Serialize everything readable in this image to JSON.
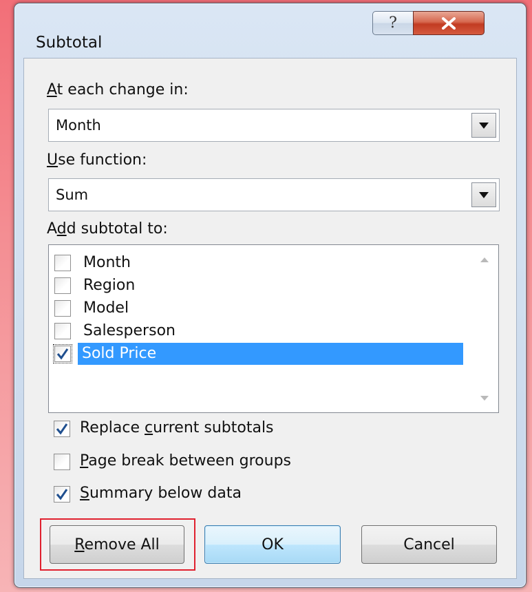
{
  "dialog": {
    "title": "Subtotal",
    "help_glyph": "?",
    "close_glyph": "x"
  },
  "at_each_change": {
    "label_key": "A",
    "label_rest": "t each change in:",
    "value": "Month"
  },
  "use_function": {
    "label_key": "U",
    "label_rest": "se function:",
    "value": "Sum"
  },
  "add_subtotal": {
    "label_pre": "A",
    "label_key": "d",
    "label_rest": "d subtotal to:",
    "items": [
      {
        "label": "Month",
        "checked": false,
        "selected": false
      },
      {
        "label": "Region",
        "checked": false,
        "selected": false
      },
      {
        "label": "Model",
        "checked": false,
        "selected": false
      },
      {
        "label": "Salesperson",
        "checked": false,
        "selected": false
      },
      {
        "label": "Sold Price",
        "checked": true,
        "selected": true
      }
    ]
  },
  "options": {
    "replace": {
      "pre": "Replace ",
      "key": "c",
      "rest": "urrent subtotals",
      "checked": true
    },
    "page_break": {
      "pre": "",
      "key": "P",
      "rest": "age break between groups",
      "checked": false
    },
    "summary": {
      "pre": "",
      "key": "S",
      "rest": "ummary below data",
      "checked": true
    }
  },
  "buttons": {
    "remove_all": {
      "key": "R",
      "rest": "emove All"
    },
    "ok": "OK",
    "cancel": "Cancel"
  },
  "colors": {
    "selection": "#3399ff",
    "highlight": "#e0202e",
    "check": "#1f4f8f"
  }
}
